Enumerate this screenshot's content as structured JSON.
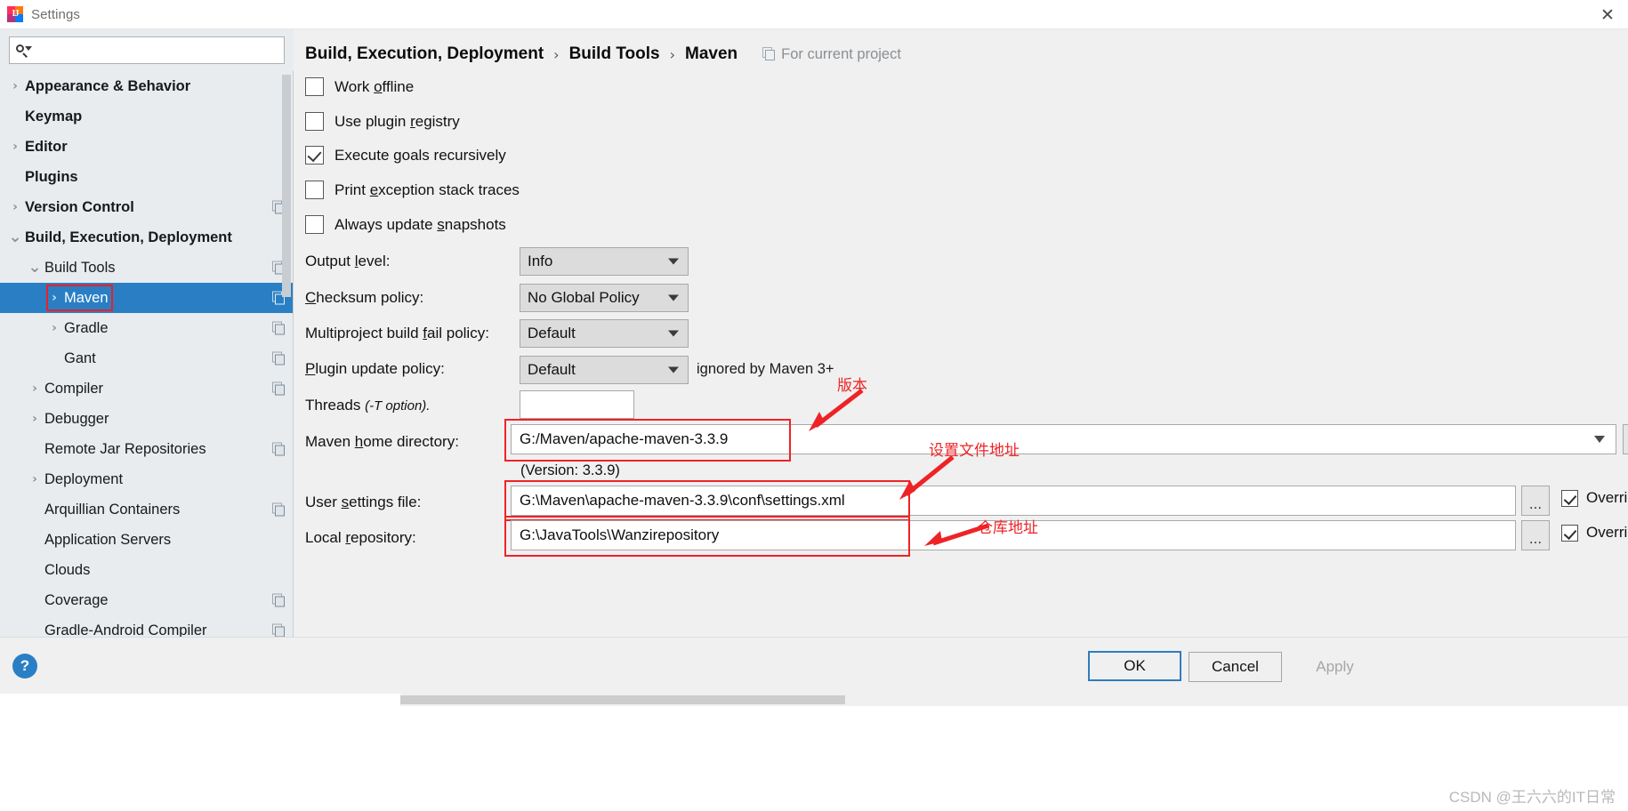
{
  "window": {
    "title": "Settings",
    "app_icon": "intellij-idea-icon",
    "close_label": "✕"
  },
  "search": {
    "placeholder": "",
    "value": "",
    "icon": "search-icon"
  },
  "sidebar": {
    "items": [
      {
        "label": "Appearance & Behavior",
        "indent": 0,
        "arrow": "collapsed",
        "bold": true,
        "selected": false,
        "copy_icon": false
      },
      {
        "label": "Keymap",
        "indent": 0,
        "arrow": "none",
        "bold": true,
        "selected": false,
        "copy_icon": false
      },
      {
        "label": "Editor",
        "indent": 0,
        "arrow": "collapsed",
        "bold": true,
        "selected": false,
        "copy_icon": false
      },
      {
        "label": "Plugins",
        "indent": 0,
        "arrow": "none",
        "bold": true,
        "selected": false,
        "copy_icon": false
      },
      {
        "label": "Version Control",
        "indent": 0,
        "arrow": "collapsed",
        "bold": true,
        "selected": false,
        "copy_icon": true
      },
      {
        "label": "Build, Execution, Deployment",
        "indent": 0,
        "arrow": "expanded",
        "bold": true,
        "selected": false,
        "copy_icon": false
      },
      {
        "label": "Build Tools",
        "indent": 1,
        "arrow": "expanded",
        "bold": false,
        "selected": false,
        "copy_icon": true
      },
      {
        "label": "Maven",
        "indent": 2,
        "arrow": "collapsed",
        "bold": false,
        "selected": true,
        "copy_icon": true
      },
      {
        "label": "Gradle",
        "indent": 2,
        "arrow": "collapsed",
        "bold": false,
        "selected": false,
        "copy_icon": true
      },
      {
        "label": "Gant",
        "indent": 2,
        "arrow": "none",
        "bold": false,
        "selected": false,
        "copy_icon": true
      },
      {
        "label": "Compiler",
        "indent": 1,
        "arrow": "collapsed",
        "bold": false,
        "selected": false,
        "copy_icon": true
      },
      {
        "label": "Debugger",
        "indent": 1,
        "arrow": "collapsed",
        "bold": false,
        "selected": false,
        "copy_icon": false
      },
      {
        "label": "Remote Jar Repositories",
        "indent": 1,
        "arrow": "none",
        "bold": false,
        "selected": false,
        "copy_icon": true
      },
      {
        "label": "Deployment",
        "indent": 1,
        "arrow": "collapsed",
        "bold": false,
        "selected": false,
        "copy_icon": false
      },
      {
        "label": "Arquillian Containers",
        "indent": 1,
        "arrow": "none",
        "bold": false,
        "selected": false,
        "copy_icon": true
      },
      {
        "label": "Application Servers",
        "indent": 1,
        "arrow": "none",
        "bold": false,
        "selected": false,
        "copy_icon": false
      },
      {
        "label": "Clouds",
        "indent": 1,
        "arrow": "none",
        "bold": false,
        "selected": false,
        "copy_icon": false
      },
      {
        "label": "Coverage",
        "indent": 1,
        "arrow": "none",
        "bold": false,
        "selected": false,
        "copy_icon": true
      },
      {
        "label": "Gradle-Android Compiler",
        "indent": 1,
        "arrow": "none",
        "bold": false,
        "selected": false,
        "copy_icon": true
      }
    ]
  },
  "breadcrumb": {
    "segments": [
      "Build, Execution, Deployment",
      "Build Tools",
      "Maven"
    ],
    "separator": "›",
    "scope_label": "For current project",
    "scope_icon": "project-scope-icon"
  },
  "main": {
    "checkboxes": [
      {
        "label_pre": "Work ",
        "mnemonic": "o",
        "label_post": "ffline",
        "checked": false
      },
      {
        "label_pre": "Use plugin ",
        "mnemonic": "r",
        "label_post": "egistry",
        "checked": false
      },
      {
        "label_pre": "Execute ",
        "mnemonic": "g",
        "label_post": "oals recursively",
        "checked": true
      },
      {
        "label_pre": "Print ",
        "mnemonic": "e",
        "label_post": "xception stack traces",
        "checked": false
      },
      {
        "label_pre": "Always update ",
        "mnemonic": "s",
        "label_post": "napshots",
        "checked": false
      }
    ],
    "combos": [
      {
        "label_pre": "Output ",
        "mnemonic": "l",
        "label_post": "evel:",
        "value": "Info",
        "note": ""
      },
      {
        "label_pre": "",
        "mnemonic": "C",
        "label_post": "hecksum policy:",
        "value": "No Global Policy",
        "note": ""
      },
      {
        "label_pre": "Multiproject build ",
        "mnemonic": "f",
        "label_post": "ail policy:",
        "value": "Default",
        "note": ""
      },
      {
        "label_pre": "",
        "mnemonic": "P",
        "label_post": "lugin update policy:",
        "value": "Default",
        "note": "ignored by Maven 3+"
      }
    ],
    "threads": {
      "label": "Threads",
      "hint": "(-T option).",
      "value": ""
    },
    "maven_home": {
      "label_pre": "Maven ",
      "mnemonic": "h",
      "label_post": "ome directory:",
      "value": "G:/Maven/apache-maven-3.3.9",
      "version_note": "(Version: 3.3.9)",
      "browse_label": "..."
    },
    "user_settings": {
      "label_pre": "User ",
      "mnemonic": "s",
      "label_post": "ettings file:",
      "value": "G:\\Maven\\apache-maven-3.3.9\\conf\\settings.xml",
      "browse_label": "...",
      "override_label": "Override",
      "override_checked": true
    },
    "local_repo": {
      "label_pre": "Local ",
      "mnemonic": "r",
      "label_post": "epository:",
      "value": "G:\\JavaTools\\Wanzirepository",
      "browse_label": "...",
      "override_label": "Override",
      "override_checked": true
    },
    "annotations": [
      {
        "text": "版本",
        "name": "annotation-version"
      },
      {
        "text": "设置文件地址",
        "name": "annotation-settings-file-path"
      },
      {
        "text": "仓库地址",
        "name": "annotation-repository-path"
      }
    ]
  },
  "footer": {
    "help_label": "?",
    "ok_label": "OK",
    "cancel_label": "Cancel",
    "apply_label": "Apply"
  },
  "watermark": {
    "text": "CSDN @王六六的IT日常"
  },
  "colors": {
    "selection_blue": "#2a7fc4",
    "annotation_red": "#ee2326",
    "sidebar_bg": "#e8ecef",
    "content_bg": "#f0f0f0"
  }
}
